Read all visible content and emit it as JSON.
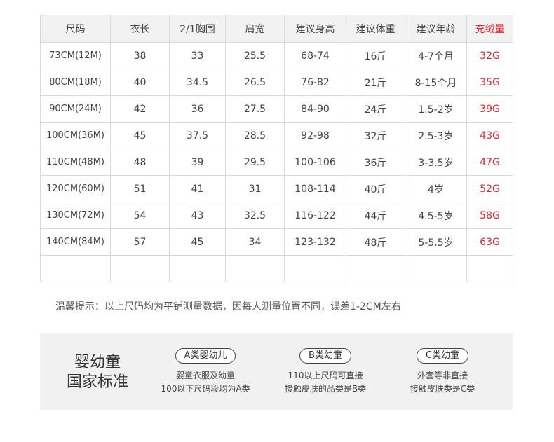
{
  "table": {
    "headers": [
      {
        "text": "尺码",
        "color": "#444444"
      },
      {
        "text": "衣长",
        "color": "#444444"
      },
      {
        "text": "2/1胸围",
        "color": "#444444"
      },
      {
        "text": "肩宽",
        "color": "#444444"
      },
      {
        "text": "建议身高",
        "color": "#444444"
      },
      {
        "text": "建议体重",
        "color": "#444444"
      },
      {
        "text": "建议年龄",
        "color": "#444444"
      },
      {
        "text": "充绒量",
        "color": "#e8232b"
      }
    ],
    "rows": [
      [
        "73CM(12M)",
        "38",
        "33",
        "25.5",
        "68-74",
        "16斤",
        "4-7个月",
        "32G"
      ],
      [
        "80CM(18M)",
        "40",
        "34.5",
        "26.5",
        "76-82",
        "21斤",
        "8-15个月",
        "35G"
      ],
      [
        "90CM(24M)",
        "42",
        "36",
        "27.5",
        "84-90",
        "24斤",
        "1.5-2岁",
        "39G"
      ],
      [
        "100CM(36M)",
        "45",
        "37.5",
        "28.5",
        "92-98",
        "32斤",
        "2.5-3岁",
        "43G"
      ],
      [
        "110CM(48M)",
        "48",
        "39",
        "29.5",
        "100-106",
        "36斤",
        "3-3.5岁",
        "47G"
      ],
      [
        "120CM(60M)",
        "51",
        "41",
        "31",
        "108-114",
        "40斤",
        "4岁",
        "52G"
      ],
      [
        "130CM(72M)",
        "54",
        "43",
        "32.5",
        "116-122",
        "44斤",
        "4.5-5岁",
        "58G"
      ],
      [
        "140CM(84M)",
        "57",
        "45",
        "34",
        "123-132",
        "48斤",
        "5-5.5岁",
        "63G"
      ],
      [
        "",
        "",
        "",
        "",
        "",
        "",
        "",
        ""
      ]
    ]
  },
  "note": "温馨提示：以上尺码均为平铺测量数据，因每人测量位置不同，误差1-2CM左右",
  "standard": {
    "title_line1": "婴幼童",
    "title_line2": "国家标准",
    "categories": [
      {
        "label": "A类婴幼儿",
        "line1": "婴童衣服及幼童",
        "line2": "100以下尺码段均为A类"
      },
      {
        "label": "B类幼童",
        "line1": "110以上尺码可直接",
        "line2": "接触皮肤的品类是B类"
      },
      {
        "label": "C类幼童",
        "line1": "外套等非直接",
        "line2": "接触皮肤类是C类"
      }
    ]
  }
}
